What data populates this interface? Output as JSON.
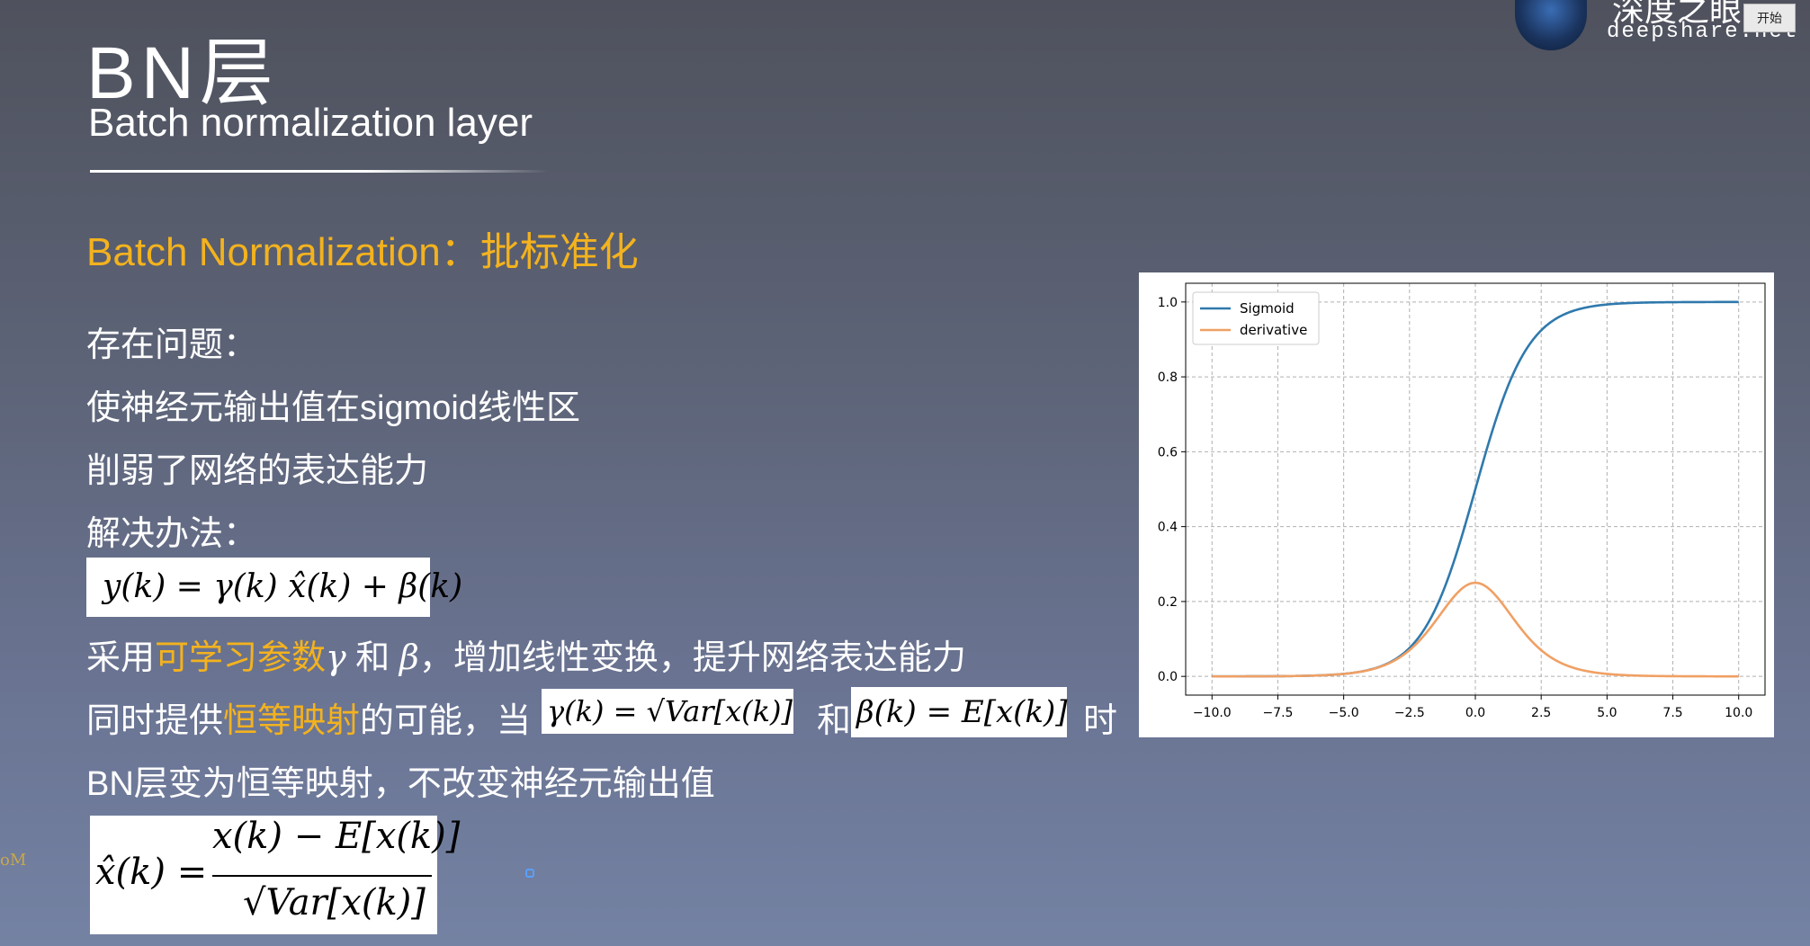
{
  "header": {
    "title": "BN层",
    "subtitle": "Batch normalization layer"
  },
  "brand": {
    "name_top": "深度之眼",
    "site": "deepshare.net",
    "start_button": "开始"
  },
  "section": {
    "heading": "Batch Normalization：批标准化"
  },
  "body": {
    "l1": "存在问题：",
    "l2": "使神经元输出值在sigmoid线性区",
    "l3": "削弱了网络的表达能力",
    "l4": "解决办法：",
    "l5_a": "采用",
    "l5_hl": "可学习参数",
    "l5_gamma": "γ",
    "l5_b": " 和 ",
    "l5_beta": "β",
    "l5_c": "，增加线性变换，提升网络表达能力",
    "l6_a": "同时提供",
    "l6_hl": "恒等映射",
    "l6_b": "的可能，当",
    "l6_and": "和",
    "l6_when": "时",
    "l7": "BN层变为恒等映射，不改变神经元输出值",
    "edge_mark": "oM"
  },
  "formulas": {
    "f1": "y(k) = γ(k) x̂(k) + β(k)",
    "f2": "γ(k) = √Var[x(k)]",
    "f3": "β(k) = E[x(k)]",
    "f4_lhs": "x̂(k) =",
    "f4_num": "x(k) − E[x(k)]",
    "f4_den": "√Var[x(k)]"
  },
  "chart_data": {
    "type": "line",
    "x_range": [
      -10,
      10
    ],
    "ylim": [
      0,
      1.0
    ],
    "x_ticks": [
      "−10.0",
      "−7.5",
      "−5.0",
      "−2.5",
      "0.0",
      "2.5",
      "5.0",
      "7.5",
      "10.0"
    ],
    "y_ticks": [
      "0.0",
      "0.2",
      "0.4",
      "0.6",
      "0.8",
      "1.0"
    ],
    "grid": true,
    "legend_position": "top-left",
    "series": [
      {
        "name": "Sigmoid",
        "color": "#2f79ad",
        "function": "1/(1+exp(-x))"
      },
      {
        "name": "derivative",
        "color": "#f0a064",
        "function": "s(x)*(1-s(x))"
      }
    ],
    "peak_derivative": {
      "x": 0,
      "y": 0.25
    }
  }
}
